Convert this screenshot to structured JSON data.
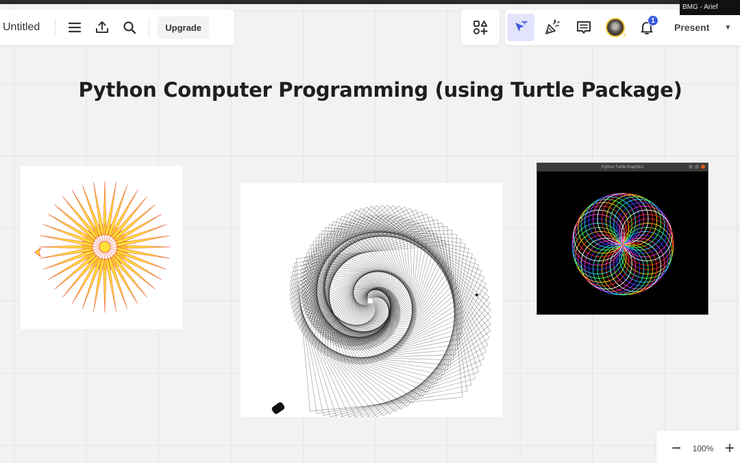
{
  "toolbar": {
    "document_title": "Untitled",
    "upgrade_label": "Upgrade",
    "present_label": "Present",
    "notification_count": "1",
    "presenter_name_tag": "BMG - Arief"
  },
  "board": {
    "heading": "Python Computer Programming (using Turtle Package)",
    "images": [
      {
        "name": "sun-starburst",
        "colors": {
          "fill": "#ffe03a",
          "stroke": "#e8552b"
        }
      },
      {
        "name": "square-spiral",
        "colors": {
          "stroke": "#2a2a2a"
        }
      },
      {
        "name": "turtle-graphics-window",
        "window_title": "Python Turtle Graphics"
      }
    ]
  },
  "zoom": {
    "level": "100%",
    "minus_label": "−",
    "plus_label": "+"
  },
  "colors": {
    "accent": "#3b5bdb",
    "active_tool_bg": "#e3e4fb",
    "active_tool_fg": "#4a5bd8",
    "canvas_bg": "#f2f2f2",
    "avatar_ring": "#f4c430"
  }
}
